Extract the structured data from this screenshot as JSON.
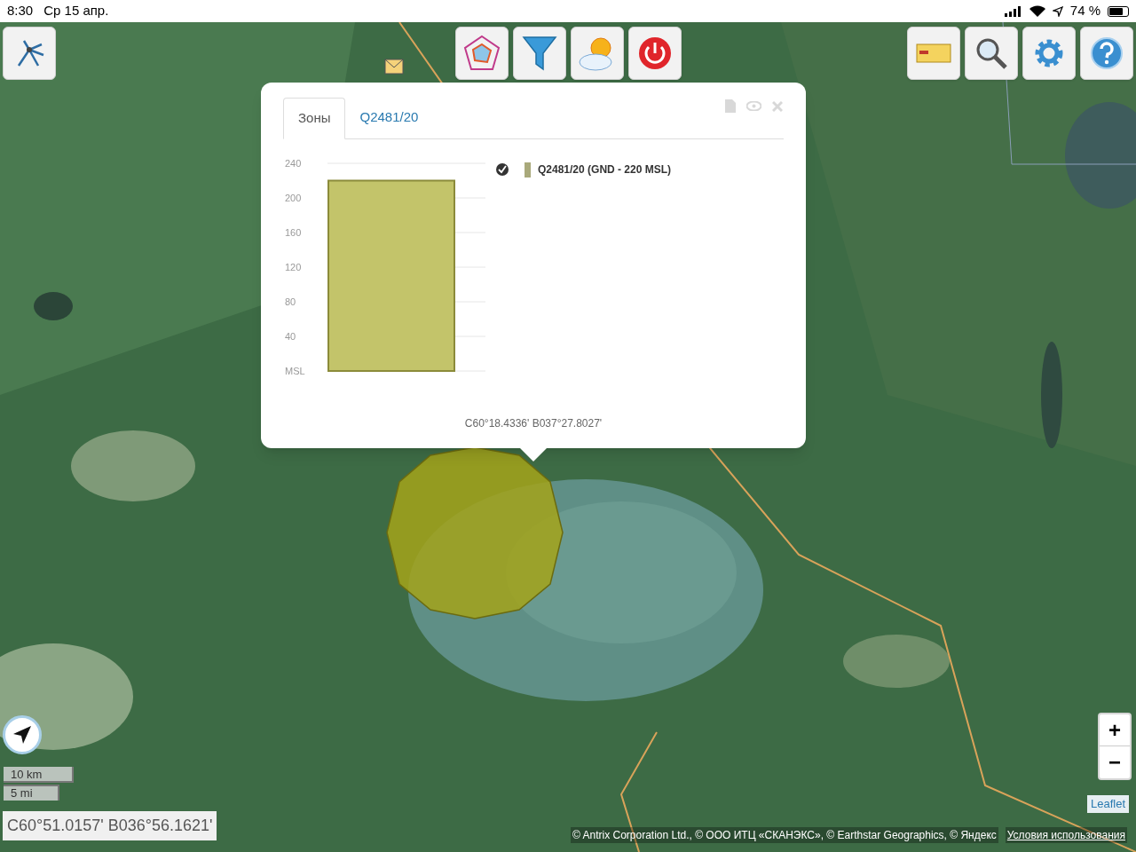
{
  "status_bar": {
    "time": "8:30",
    "date": "Ср 15 апр.",
    "battery": "74 %"
  },
  "popup": {
    "tabs": [
      {
        "label": "Зоны",
        "selected": true
      },
      {
        "label": "Q2481/20",
        "selected": false
      }
    ],
    "legend": [
      {
        "checked": true,
        "color": "#a9a97b"
      }
    ],
    "chart_data": {
      "type": "bar",
      "grid": true,
      "series": [
        {
          "name": "Q2481/20 (GND - 220 MSL)",
          "color": "#c3c46a",
          "values": [
            220
          ]
        }
      ],
      "ylim": [
        0,
        240
      ],
      "yticks": [
        {
          "value": 0,
          "label": "MSL"
        },
        40,
        80,
        120,
        160,
        200,
        240
      ]
    },
    "coordinates": "С60°18.4336' В037°27.8027'"
  },
  "scale": {
    "metric": "10 km",
    "imperial": "5 mi"
  },
  "cursor_coordinates": "С60°51.0157' В036°56.1621'",
  "zoom": {
    "in": "+",
    "out": "−"
  },
  "attribution": {
    "text": "© Antrix Corporation Ltd., © ООО ИТЦ «СКАНЭКС», © Earthstar Geographics, © Яндекс",
    "terms_link": "Условия использования",
    "leaflet_link": "Leaflet"
  }
}
